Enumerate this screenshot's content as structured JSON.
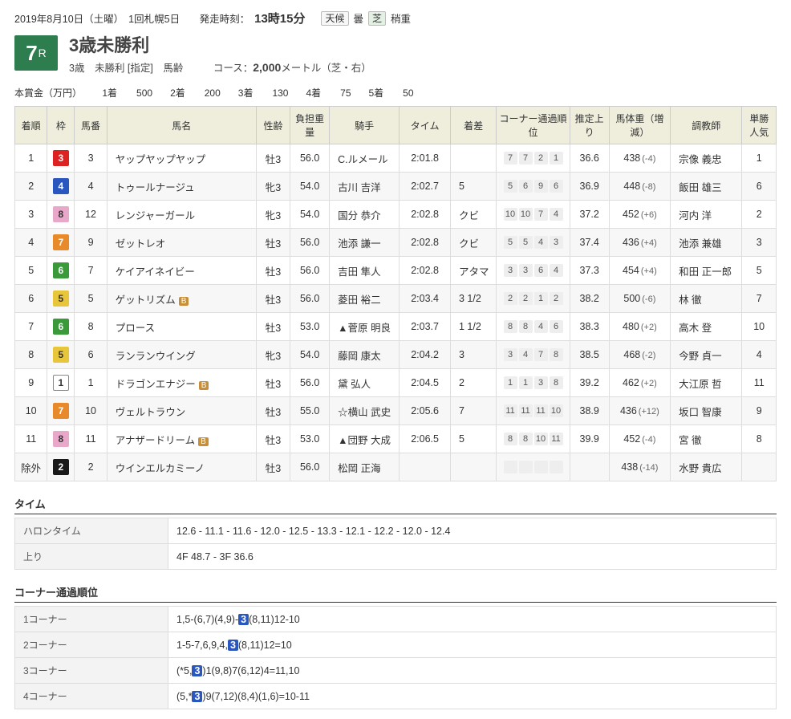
{
  "header": {
    "date": "2019年8月10日（土曜）",
    "place": "1回札幌5日",
    "start_label": "発走時刻：",
    "start_time": "13時15分",
    "weather_label": "天候",
    "weather": "曇",
    "track_label": "芝",
    "track": "稍重"
  },
  "race": {
    "number": "7",
    "number_suffix": "R",
    "name": "3歳未勝利",
    "sub": "3歳　未勝利 [指定]　馬齢　　　コース：",
    "course_bold": "2,000",
    "course_suffix": "メートル（芝・右）"
  },
  "prize": {
    "label": "本賞金（万円）",
    "items": [
      {
        "rank": "1着",
        "amount": "500"
      },
      {
        "rank": "2着",
        "amount": "200"
      },
      {
        "rank": "3着",
        "amount": "130"
      },
      {
        "rank": "4着",
        "amount": "75"
      },
      {
        "rank": "5着",
        "amount": "50"
      }
    ]
  },
  "columns": [
    "着順",
    "枠",
    "馬番",
    "馬名",
    "性齢",
    "負担重量",
    "騎手",
    "タイム",
    "着差",
    "コーナー通過順位",
    "推定上り",
    "馬体重（増減）",
    "調教師",
    "単勝人気"
  ],
  "rows": [
    {
      "rank": "1",
      "waku": "3",
      "wclass": "w3",
      "num": "3",
      "horse": "ヤップヤップヤップ",
      "b": "",
      "sex": "牡3",
      "wgt": "56.0",
      "jockey": "C.ルメール",
      "time": "2:01.8",
      "margin": "",
      "corner": [
        "7",
        "7",
        "2",
        "1"
      ],
      "agari": "36.6",
      "bw": "438",
      "bwd": "(-4)",
      "trainer": "宗像 義忠",
      "pop": "1"
    },
    {
      "rank": "2",
      "waku": "4",
      "wclass": "w4",
      "num": "4",
      "horse": "トゥールナージュ",
      "b": "",
      "sex": "牝3",
      "wgt": "54.0",
      "jockey": "古川 吉洋",
      "time": "2:02.7",
      "margin": "5",
      "corner": [
        "5",
        "6",
        "9",
        "6"
      ],
      "agari": "36.9",
      "bw": "448",
      "bwd": "(-8)",
      "trainer": "飯田 雄三",
      "pop": "6"
    },
    {
      "rank": "3",
      "waku": "8",
      "wclass": "w8",
      "num": "12",
      "horse": "レンジャーガール",
      "b": "",
      "sex": "牝3",
      "wgt": "54.0",
      "jockey": "国分 恭介",
      "time": "2:02.8",
      "margin": "クビ",
      "corner": [
        "10",
        "10",
        "7",
        "4"
      ],
      "agari": "37.2",
      "bw": "452",
      "bwd": "(+6)",
      "trainer": "河内 洋",
      "pop": "2"
    },
    {
      "rank": "4",
      "waku": "7",
      "wclass": "w7",
      "num": "9",
      "horse": "ゼットレオ",
      "b": "",
      "sex": "牡3",
      "wgt": "56.0",
      "jockey": "池添 謙一",
      "time": "2:02.8",
      "margin": "クビ",
      "corner": [
        "5",
        "5",
        "4",
        "3"
      ],
      "agari": "37.4",
      "bw": "436",
      "bwd": "(+4)",
      "trainer": "池添 兼雄",
      "pop": "3"
    },
    {
      "rank": "5",
      "waku": "6",
      "wclass": "w6",
      "num": "7",
      "horse": "ケイアイネイビー",
      "b": "",
      "sex": "牡3",
      "wgt": "56.0",
      "jockey": "吉田 隼人",
      "time": "2:02.8",
      "margin": "アタマ",
      "corner": [
        "3",
        "3",
        "6",
        "4"
      ],
      "agari": "37.3",
      "bw": "454",
      "bwd": "(+4)",
      "trainer": "和田 正一郎",
      "pop": "5"
    },
    {
      "rank": "6",
      "waku": "5",
      "wclass": "w5",
      "num": "5",
      "horse": "ゲットリズム",
      "b": "B",
      "sex": "牡3",
      "wgt": "56.0",
      "jockey": "菱田 裕二",
      "time": "2:03.4",
      "margin": "3 1/2",
      "corner": [
        "2",
        "2",
        "1",
        "2"
      ],
      "agari": "38.2",
      "bw": "500",
      "bwd": "(-6)",
      "trainer": "林 徹",
      "pop": "7"
    },
    {
      "rank": "7",
      "waku": "6",
      "wclass": "w6",
      "num": "8",
      "horse": "プロース",
      "b": "",
      "sex": "牡3",
      "wgt": "53.0",
      "jockey": "▲菅原 明良",
      "time": "2:03.7",
      "margin": "1 1/2",
      "corner": [
        "8",
        "8",
        "4",
        "6"
      ],
      "agari": "38.3",
      "bw": "480",
      "bwd": "(+2)",
      "trainer": "高木 登",
      "pop": "10"
    },
    {
      "rank": "8",
      "waku": "5",
      "wclass": "w5",
      "num": "6",
      "horse": "ランランウイング",
      "b": "",
      "sex": "牝3",
      "wgt": "54.0",
      "jockey": "藤岡 康太",
      "time": "2:04.2",
      "margin": "3",
      "corner": [
        "3",
        "4",
        "7",
        "8"
      ],
      "agari": "38.5",
      "bw": "468",
      "bwd": "(-2)",
      "trainer": "今野 貞一",
      "pop": "4"
    },
    {
      "rank": "9",
      "waku": "1",
      "wclass": "w1",
      "num": "1",
      "horse": "ドラゴンエナジー",
      "b": "B",
      "sex": "牡3",
      "wgt": "56.0",
      "jockey": "黛 弘人",
      "time": "2:04.5",
      "margin": "2",
      "corner": [
        "1",
        "1",
        "3",
        "8"
      ],
      "agari": "39.2",
      "bw": "462",
      "bwd": "(+2)",
      "trainer": "大江原 哲",
      "pop": "11"
    },
    {
      "rank": "10",
      "waku": "7",
      "wclass": "w7",
      "num": "10",
      "horse": "ヴェルトラウン",
      "b": "",
      "sex": "牡3",
      "wgt": "55.0",
      "jockey": "☆横山 武史",
      "time": "2:05.6",
      "margin": "7",
      "corner": [
        "11",
        "11",
        "11",
        "10"
      ],
      "agari": "38.9",
      "bw": "436",
      "bwd": "(+12)",
      "trainer": "坂口 智康",
      "pop": "9"
    },
    {
      "rank": "11",
      "waku": "8",
      "wclass": "w8",
      "num": "11",
      "horse": "アナザードリーム",
      "b": "B",
      "sex": "牡3",
      "wgt": "53.0",
      "jockey": "▲団野 大成",
      "time": "2:06.5",
      "margin": "5",
      "corner": [
        "8",
        "8",
        "10",
        "11"
      ],
      "agari": "39.9",
      "bw": "452",
      "bwd": "(-4)",
      "trainer": "宮 徹",
      "pop": "8"
    },
    {
      "rank": "除外",
      "waku": "2",
      "wclass": "w2",
      "num": "2",
      "horse": "ウインエルカミーノ",
      "b": "",
      "sex": "牡3",
      "wgt": "56.0",
      "jockey": "松岡 正海",
      "time": "",
      "margin": "",
      "corner": [
        "",
        "",
        "",
        ""
      ],
      "agari": "",
      "bw": "438",
      "bwd": "(-14)",
      "trainer": "水野 貴広",
      "pop": ""
    }
  ],
  "time_section": {
    "title": "タイム",
    "furlong_label": "ハロンタイム",
    "furlong": "12.6 - 11.1 - 11.6 - 12.0 - 12.5 - 13.3 - 12.1 - 12.2 - 12.0 - 12.4",
    "agari_label": "上り",
    "agari": "4F 48.7 - 3F 36.6"
  },
  "corner_section": {
    "title": "コーナー通過順位",
    "rows": [
      {
        "label": "1コーナー",
        "pre": "1,5-(6,7)(4,9)-",
        "hl": "3",
        "post": "(8,11)12-10"
      },
      {
        "label": "2コーナー",
        "pre": "1-5-7,6,9,4,",
        "hl": "3",
        "post": "(8,11)12=10"
      },
      {
        "label": "3コーナー",
        "pre": "(*5,",
        "hl": "3",
        "post": ")1(9,8)7(6,12)4=11,10"
      },
      {
        "label": "4コーナー",
        "pre": "(5,*",
        "hl": "3",
        "post": ")9(7,12)(8,4)(1,6)=10-11"
      }
    ]
  }
}
